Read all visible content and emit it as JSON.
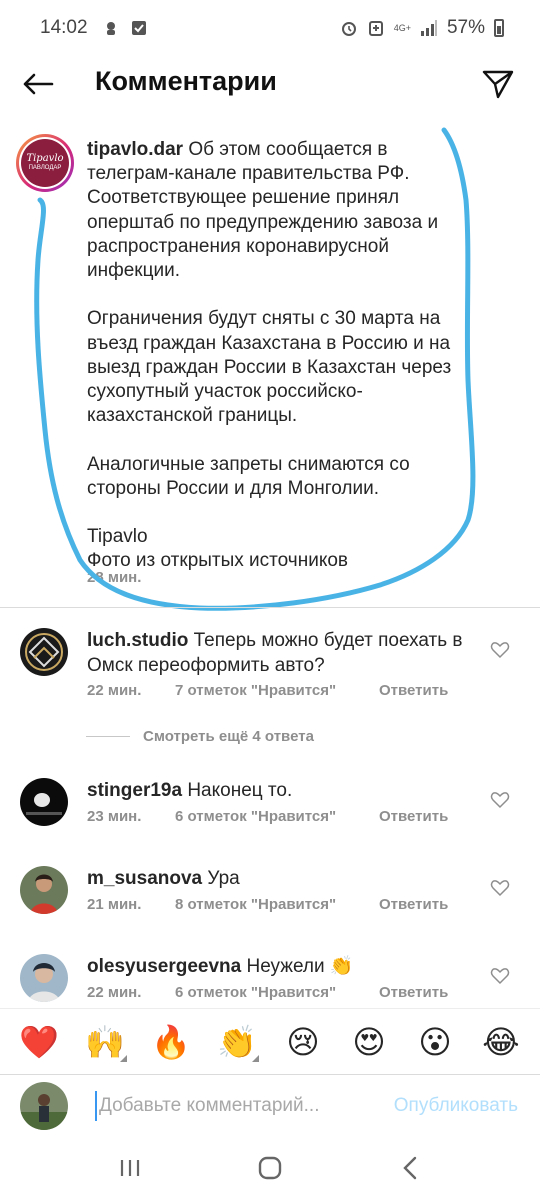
{
  "status_bar": {
    "time": "14:02",
    "network": "4G+",
    "battery": "57%"
  },
  "header": {
    "title": "Комментарии"
  },
  "caption": {
    "username": "tipavlo.dar",
    "text": " Об этом сообщается в телеграм-канале правительства РФ. Соответствующее решение принял оперштаб по предупреждению завоза и распространения коронавирусной инфекции.\n\nОграничения будут сняты с 30 марта на въезд граждан Казахстана в Россию и на выезд граждан России в Казахстан через сухопутный участок российско-казахстанской границы.\n\nАналогичные запреты снимаются со стороны России и для Монголии.\n\nTipavlo\nФото из открытых источников",
    "time": "28 мин."
  },
  "comments": [
    {
      "username": "luch.studio",
      "text": " Теперь можно будет поехать в Омск переоформить авто?",
      "time": "22 мин.",
      "likes": "7 отметок \"Нравится\"",
      "reply": "Ответить"
    },
    {
      "username": "stinger19a",
      "text": " Наконец то.",
      "time": "23 мин.",
      "likes": "6 отметок \"Нравится\"",
      "reply": "Ответить"
    },
    {
      "username": "m_susanova",
      "text": " Ура",
      "time": "21 мин.",
      "likes": "8 отметок \"Нравится\"",
      "reply": "Ответить"
    },
    {
      "username": "olesyusergeevna",
      "text": " Неужели 👏",
      "time": "22 мин.",
      "likes": "6 отметок \"Нравится\"",
      "reply": "Ответить"
    }
  ],
  "more_replies": "Смотреть ещё 4 ответа",
  "emoji_bar": [
    "❤️",
    "🙌",
    "🔥",
    "👏",
    "😢",
    "😍",
    "😮",
    "😂"
  ],
  "input": {
    "placeholder": "Добавьте комментарий...",
    "publish": "Опубликовать"
  },
  "brand_logo": {
    "line1": "Tipavlo",
    "line2": "ПАВЛОДАР"
  },
  "colors": {
    "scribble": "#4ab3e6",
    "link_disabled": "#b2dffc",
    "meta_gray": "#8e8e8e"
  }
}
